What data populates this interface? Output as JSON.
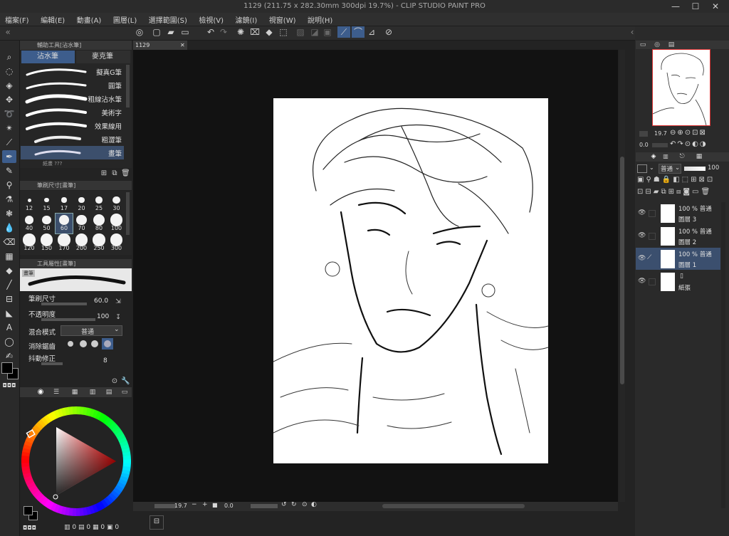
{
  "window": {
    "title": "1129 (211.75 x 282.30mm 300dpi 19.7%) - CLIP STUDIO PAINT PRO",
    "minimize": "—",
    "restore": "☐",
    "close": "✕"
  },
  "menu": [
    "檔案(F)",
    "編輯(E)",
    "動畫(A)",
    "圖層(L)",
    "選擇範圍(S)",
    "檢視(V)",
    "濾鏡(I)",
    "視窗(W)",
    "說明(H)"
  ],
  "sub_tool_panel": {
    "header": "輔助工具[沾水筆]",
    "tabs": [
      "沾水筆",
      "麥克筆"
    ],
    "brushes": [
      "擬真G筆",
      "圓筆",
      "粗線沾水筆",
      "美術字",
      "效果線用",
      "粗澀筆",
      "畫筆"
    ],
    "selected_index": 6,
    "footer_partial": "紙畫 ???"
  },
  "brush_size_panel": {
    "header": "筆刷尺寸[畫筆]",
    "sizes": [
      "12",
      "15",
      "17",
      "20",
      "25",
      "30",
      "40",
      "50",
      "60",
      "70",
      "80",
      "100",
      "120",
      "150",
      "170",
      "200",
      "250",
      "300"
    ],
    "selected": "60"
  },
  "tool_property_panel": {
    "header": "工具屬性[畫筆]",
    "preview_label": "畫筆",
    "brush_size_label": "筆刷尺寸",
    "brush_size_value": "60.0",
    "opacity_label": "不透明度",
    "opacity_value": "100",
    "blend_label": "混合模式",
    "blend_value": "普通",
    "antialias_label": "消除鋸齒",
    "stabilization_label": "抖動修正",
    "stabilization_value": "8"
  },
  "color_panel": {
    "counts": [
      "0",
      "0",
      "0",
      "0"
    ]
  },
  "document": {
    "tab_label": "1129",
    "zoom": "19.7",
    "angle": "0.0"
  },
  "navigator": {
    "zoom": "19.7",
    "angle": "0.0"
  },
  "layer_panel": {
    "blend_mode": "普通",
    "opacity": "100",
    "layers": [
      {
        "mode": "100 % 普通",
        "name": "圖層 3",
        "selected": false
      },
      {
        "mode": "100 % 普通",
        "name": "圖層 2",
        "selected": false
      },
      {
        "mode": "100 % 普通",
        "name": "圖層 1",
        "selected": true
      },
      {
        "mode": "",
        "name": "紙張",
        "selected": false
      }
    ]
  },
  "colors": {
    "accent": "#3d5d8c",
    "panel": "#2a2a2a",
    "canvas_bg": "#121212"
  }
}
